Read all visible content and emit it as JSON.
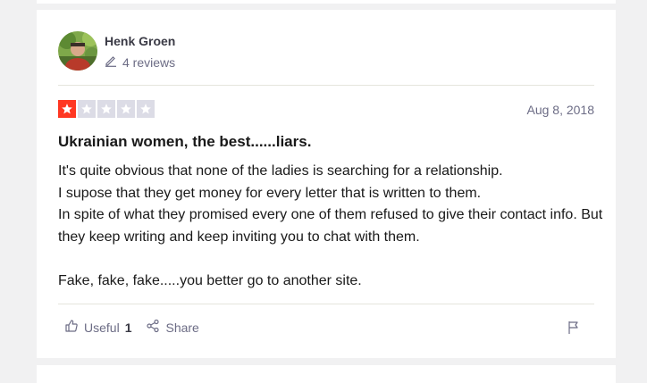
{
  "reviewer": {
    "name": "Henk Groen",
    "review_count": "4 reviews"
  },
  "review": {
    "rating": 1,
    "max_rating": 5,
    "date": "Aug 8, 2018",
    "title": "Ukrainian women, the best......liars.",
    "lines": [
      "It's quite obvious that none of the ladies is searching for a relationship.",
      "I supose that they get money for every letter that is written to them.",
      "In spite of what they promised every one of them refused to give their contact info. But they keep writing and keep inviting you to chat with them.",
      "Fake, fake, fake.....you better go to another site."
    ]
  },
  "actions": {
    "useful_label": "Useful",
    "useful_count": "1",
    "share_label": "Share"
  },
  "colors": {
    "star_filled": "#ff3722",
    "star_empty": "#dcdce6",
    "muted_text": "#6c6c85"
  },
  "icons": {
    "edit": "pencil-icon",
    "useful": "thumbs-up-icon",
    "share": "share-icon",
    "flag": "flag-icon",
    "star": "star-icon"
  }
}
